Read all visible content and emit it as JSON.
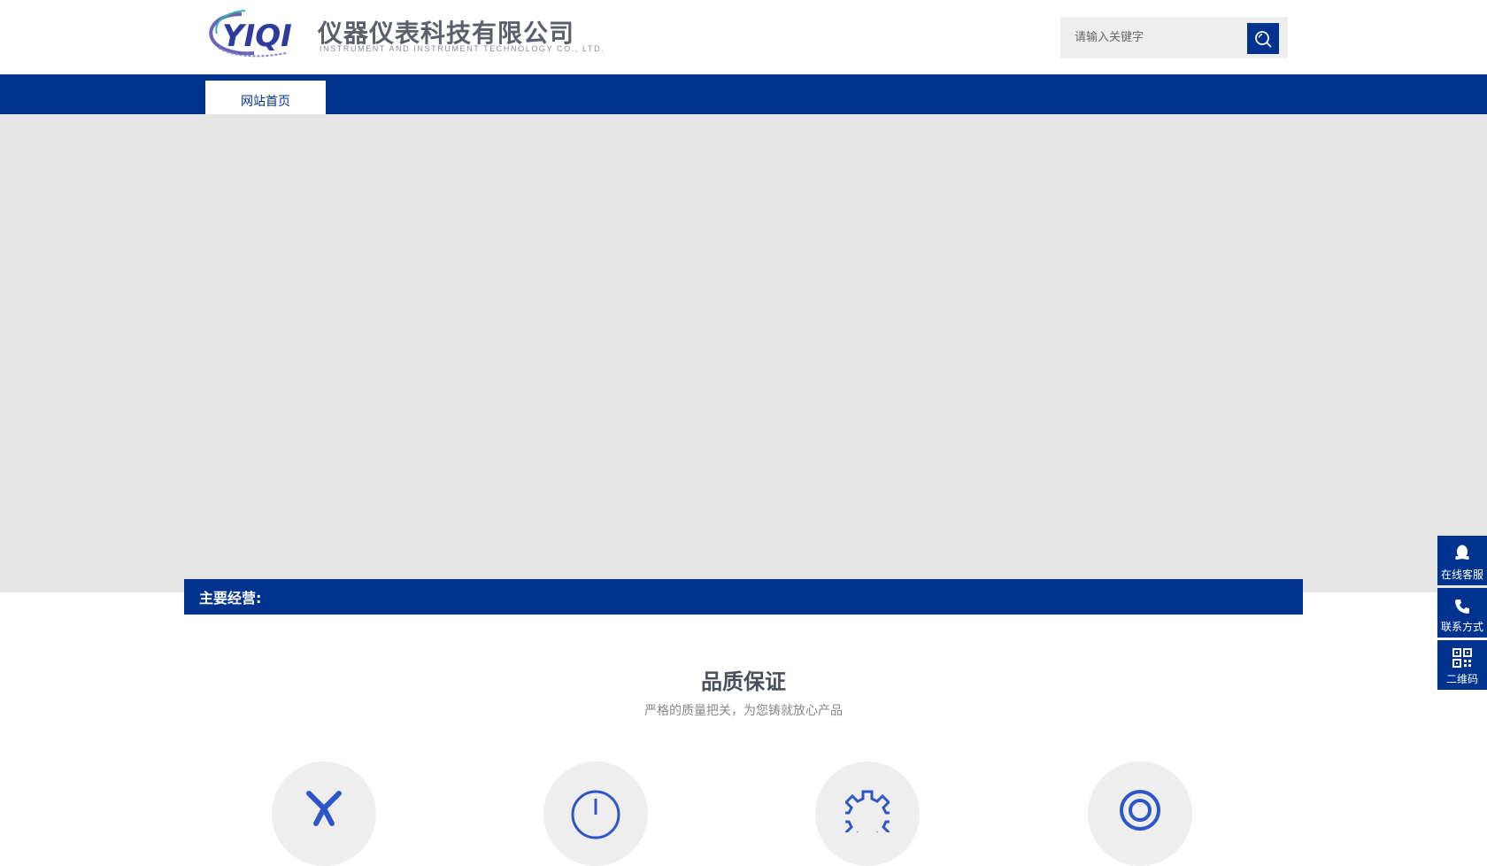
{
  "header": {
    "logo_mark_text": "YIQI",
    "company_name_cn": "仪器仪表科技有限公司",
    "company_name_en": "INSTRUMENT AND INSTRUMENT TECHNOLOGY CO., LTD."
  },
  "search": {
    "placeholder": "请输入关键字",
    "icon": "search-icon"
  },
  "nav": {
    "items": [
      {
        "label": "网站首页",
        "active": true
      }
    ]
  },
  "business": {
    "label": "主要经营:"
  },
  "quality": {
    "title": "品质保证",
    "subtitle": "严格的质量把关，为您铸就放心产品",
    "features": [
      {
        "icon": "tools-icon"
      },
      {
        "icon": "clock-icon"
      },
      {
        "icon": "gear-icon"
      },
      {
        "icon": "target-icon"
      }
    ]
  },
  "side_float": [
    {
      "label": "在线客服",
      "icon": "qq-icon"
    },
    {
      "label": "联系方式",
      "icon": "phone-icon"
    },
    {
      "label": "二维码",
      "icon": "qrcode-icon"
    }
  ],
  "colors": {
    "brand_blue": "#003390",
    "banner_gray": "#e6e6e6",
    "search_bg": "#eeeeee",
    "logo_gray": "#5b5f6b"
  }
}
